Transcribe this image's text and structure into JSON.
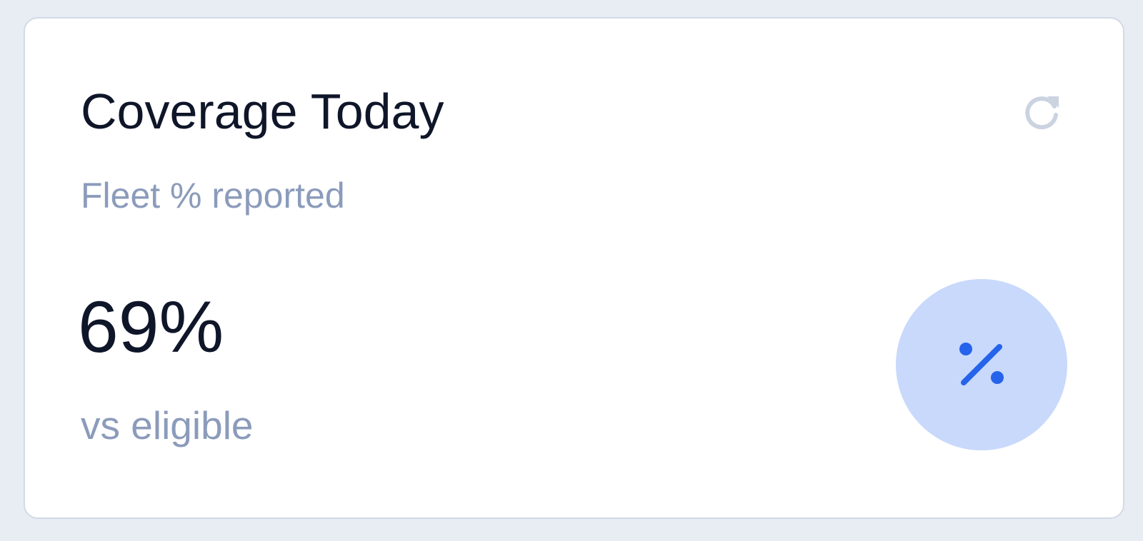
{
  "card": {
    "title": "Coverage Today",
    "subtitle": "Fleet % reported",
    "value": "69%",
    "caption": "vs eligible",
    "refresh_icon": "refresh-icon",
    "badge_icon": "percent-icon"
  },
  "colors": {
    "background": "#e8ecf3",
    "card": "#ffffff",
    "title_text": "#0f1629",
    "muted_text": "#8b9bbb",
    "badge_fill": "#c8d9fb",
    "accent": "#2563eb",
    "icon_muted": "#cbd3e1"
  }
}
